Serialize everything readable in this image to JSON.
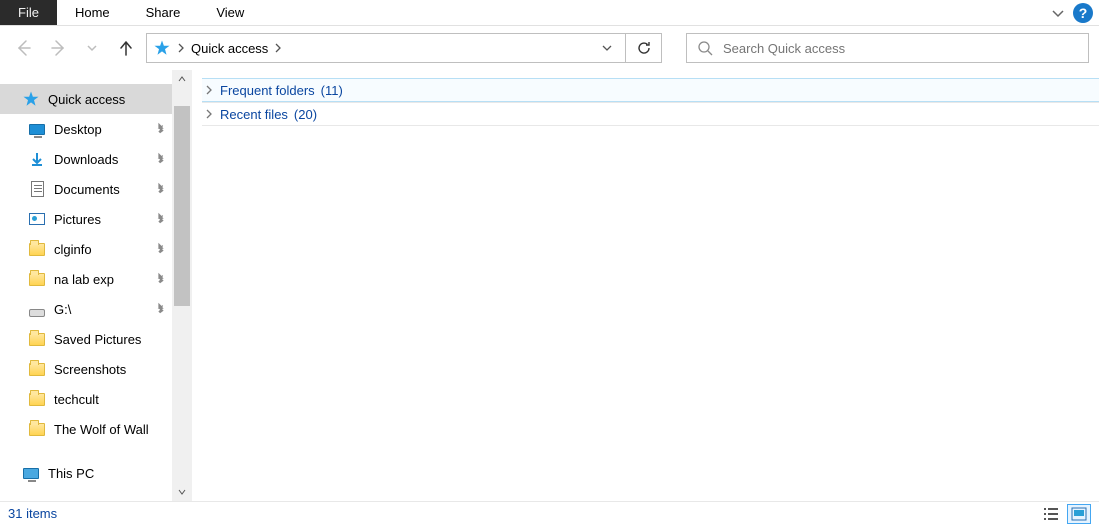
{
  "ribbon": {
    "file": "File",
    "tabs": [
      "Home",
      "Share",
      "View"
    ]
  },
  "nav": {
    "breadcrumb": "Quick access",
    "search_placeholder": "Search Quick access"
  },
  "sidebar": {
    "items": [
      {
        "label": "Quick access",
        "icon": "star",
        "pinned": false,
        "selected": true
      },
      {
        "label": "Desktop",
        "icon": "monitor",
        "pinned": true
      },
      {
        "label": "Downloads",
        "icon": "download",
        "pinned": true
      },
      {
        "label": "Documents",
        "icon": "doc",
        "pinned": true
      },
      {
        "label": "Pictures",
        "icon": "pic",
        "pinned": true
      },
      {
        "label": "clginfo",
        "icon": "folder",
        "pinned": true
      },
      {
        "label": "na lab exp",
        "icon": "folder",
        "pinned": true
      },
      {
        "label": "G:\\",
        "icon": "drive",
        "pinned": true
      },
      {
        "label": "Saved Pictures",
        "icon": "folder",
        "pinned": false
      },
      {
        "label": "Screenshots",
        "icon": "folder",
        "pinned": false
      },
      {
        "label": "techcult",
        "icon": "folder",
        "pinned": false
      },
      {
        "label": "The Wolf of Wall",
        "icon": "folder",
        "pinned": false
      },
      {
        "label": "This PC",
        "icon": "pc",
        "pinned": false
      }
    ]
  },
  "groups": [
    {
      "label": "Frequent folders",
      "count": "(11)"
    },
    {
      "label": "Recent files",
      "count": "(20)"
    }
  ],
  "status": {
    "text": "31 items"
  }
}
